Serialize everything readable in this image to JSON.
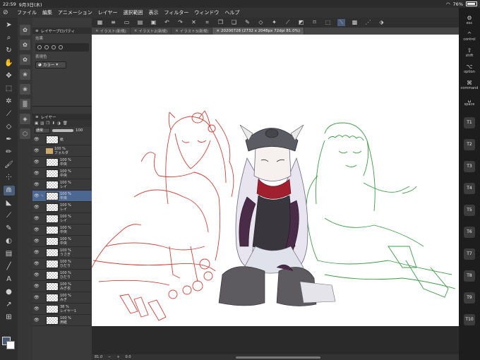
{
  "status": {
    "time": "22:59",
    "date": "9月3日(木)",
    "battery": "76%"
  },
  "menu": [
    "ファイル",
    "編集",
    "アニメーション",
    "レイヤー",
    "選択範囲",
    "表示",
    "フィルター",
    "ウィンドウ",
    "ヘルプ"
  ],
  "tabs": [
    {
      "label": "イラスト(新規)"
    },
    {
      "label": "イラスト2(新規)"
    },
    {
      "label": "イラスト3(新規)"
    },
    {
      "label": "20200728 (2732 x 2048px 72dpi 81.0%)"
    }
  ],
  "property_panel": {
    "title": "レイヤープロパティ",
    "effect_label": "効果",
    "color_label": "表現色",
    "color_value": "カラー"
  },
  "layer_panel": {
    "title": "レイヤー",
    "blend_mode": "通常",
    "opacity": "100",
    "layers": [
      {
        "pct": "",
        "name": "紙",
        "type": "paper"
      },
      {
        "pct": "100 %",
        "name": "フォルダ",
        "type": "folder"
      },
      {
        "pct": "100 %",
        "name": "中央",
        "type": "layer"
      },
      {
        "pct": "100 %",
        "name": "中央",
        "type": "layer"
      },
      {
        "pct": "100 %",
        "name": "レイ",
        "type": "layer"
      },
      {
        "pct": "100 %",
        "name": "中央",
        "type": "layer",
        "selected": true
      },
      {
        "pct": "100 %",
        "name": "レイ",
        "type": "layer"
      },
      {
        "pct": "100 %",
        "name": "レイ",
        "type": "layer"
      },
      {
        "pct": "100 %",
        "name": "中央",
        "type": "layer"
      },
      {
        "pct": "100 %",
        "name": "中央",
        "type": "layer"
      },
      {
        "pct": "100 %",
        "name": "うさぎ",
        "type": "layer"
      },
      {
        "pct": "100 %",
        "name": "ひだり",
        "type": "layer"
      },
      {
        "pct": "100 %",
        "name": "ひだり",
        "type": "layer"
      },
      {
        "pct": "100 %",
        "name": "みぎ衣",
        "type": "layer"
      },
      {
        "pct": "100 %",
        "name": "みぎ",
        "type": "layer"
      },
      {
        "pct": "38 %",
        "name": "レイヤー1",
        "type": "layer"
      },
      {
        "pct": "100 %",
        "name": "用紙",
        "type": "layer"
      }
    ]
  },
  "bottom": {
    "zoom": "81.0",
    "angle": "0.0"
  },
  "edge_keys": {
    "top": [
      {
        "label": "esc",
        "icon": "gear"
      },
      {
        "label": "control",
        "icon": "caret"
      },
      {
        "label": "shift",
        "icon": "arrow-up"
      },
      {
        "label": "option",
        "icon": "option"
      },
      {
        "label": "command",
        "icon": "command"
      },
      {
        "label": "space",
        "icon": "space"
      }
    ],
    "function_keys": [
      "T1",
      "T2",
      "T3",
      "T4",
      "T5",
      "T6",
      "T7",
      "T8",
      "T9",
      "T10"
    ]
  }
}
